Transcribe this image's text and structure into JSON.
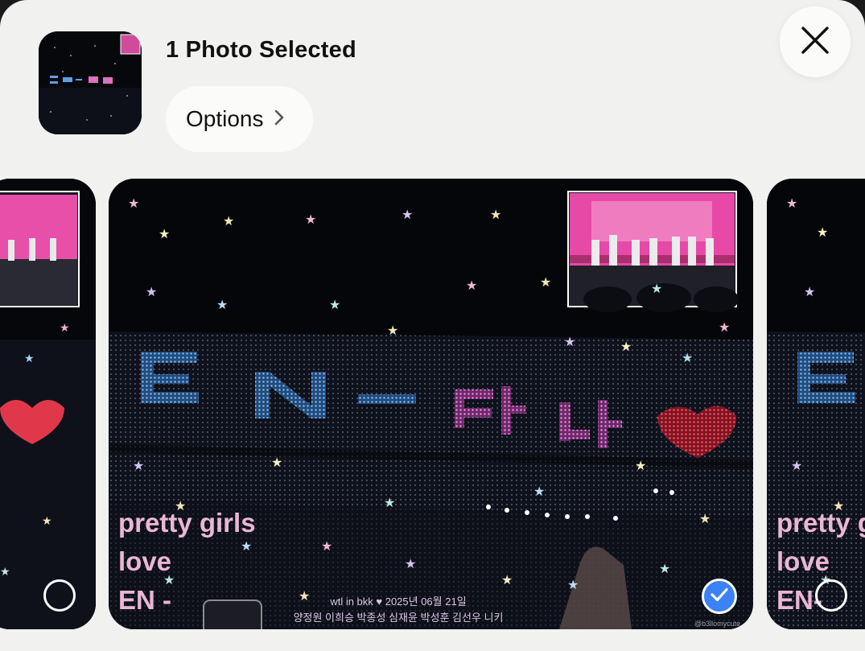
{
  "header": {
    "title": "1 Photo Selected",
    "options_label": "Options"
  },
  "photos": [
    {
      "position": "previous",
      "selected": false,
      "overlay_lines": [
        "",
        "",
        ""
      ]
    },
    {
      "position": "current",
      "selected": true,
      "overlay_lines": [
        "pretty girls",
        "love",
        "EN -"
      ],
      "caption_line1": "wtl in bkk ♥ 2025년 06월 21일",
      "caption_line2": "양정원 이희승 박종성 심재윤 박성훈 김선우 니키",
      "credit": "@b3llomycute"
    },
    {
      "position": "next",
      "selected": false,
      "overlay_lines": [
        "pretty g",
        "love",
        "EN-"
      ]
    }
  ],
  "colors": {
    "sheet_bg": "#f1f2ef",
    "button_bg": "#fbfcfa",
    "check_blue": "#3a82f6",
    "overlay_pink": "#eab6d6"
  },
  "icons": {
    "close": "close-icon",
    "options_chevron": "chevron-right-icon",
    "selected": "checkmark-icon"
  }
}
